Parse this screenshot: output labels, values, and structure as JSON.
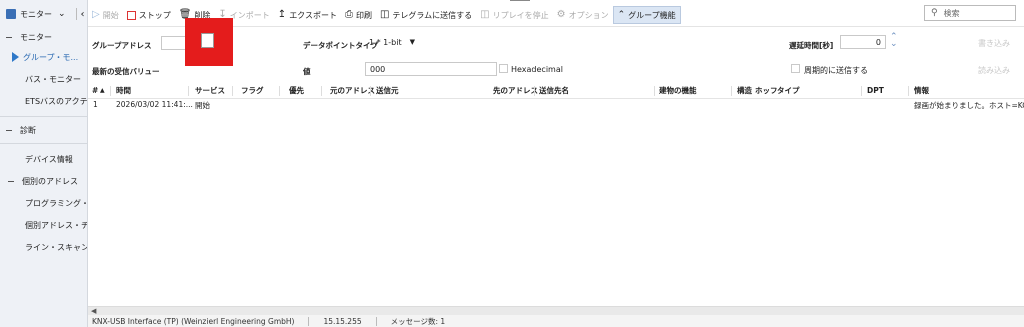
{
  "sidebar": {
    "header": "モニター",
    "groups": [
      {
        "label": "モニター"
      },
      {
        "label": "診断"
      }
    ],
    "monitor_items": [
      "グループ・モ...",
      "バス・モニター",
      "ETSバスのアクテ..."
    ],
    "diag_items": [
      "デバイス情報",
      "個別のアドレス",
      "プログラミング・モ...",
      "個別アドレス・チ...",
      "ライン・スキャン"
    ]
  },
  "toolbar": {
    "start": "開始",
    "stop": "ストップ",
    "delete": "削除",
    "import": "インポート",
    "export": "エクスポート",
    "print": "印刷",
    "send_telegram": "テレグラムに送信する",
    "stop_replay": "リプレイを停止",
    "options": "オプション",
    "group_function": "グループ機能",
    "search_placeholder": "検索"
  },
  "panel": {
    "group_address_label": "グループアドレス",
    "datapoint_type_label": "データポイントタイプ",
    "datapoint_type_value": "1.* 1-bit",
    "delay_label": "遅延時間[秒]",
    "delay_value": "0",
    "write_button": "書き込み",
    "last_value_label": "最新の受信バリュー",
    "value_label": "値",
    "value_value": "000",
    "hex_label": "Hexadecimal",
    "periodic_label": "周期的に送信する",
    "read_button": "読み込み"
  },
  "table": {
    "headers": [
      "#",
      "時間",
      "サービス",
      "フラグ",
      "優先",
      "元のアドレス",
      "送信元",
      "先のアドレス",
      "送信先名",
      "建物の機能",
      "構造",
      "ホッフ",
      "タイプ",
      "DPT",
      "情報"
    ],
    "rows": [
      {
        "num": "1",
        "time": "2026/03/02 11:41:...",
        "service": "開始",
        "info": "録画が始まりました。ホスト=KOSHI"
      }
    ]
  },
  "status": {
    "interface": "KNX-USB Interface (TP) (Weinzierl Engineering GmbH)",
    "address": "15.15.255",
    "messages": "メッセージ数: 1"
  }
}
